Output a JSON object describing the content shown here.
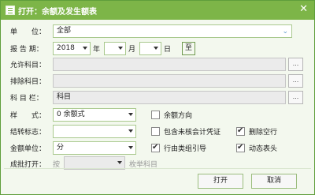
{
  "window": {
    "title": "打开：余额及发生额表",
    "close_symbol": "✕"
  },
  "form": {
    "unit": {
      "label": "单　　位：",
      "value": "全部"
    },
    "period": {
      "label": "报 告 期：",
      "year_value": "2018",
      "year_unit": "年",
      "month_value": "",
      "month_unit": "月",
      "day_value": "",
      "day_unit": "日",
      "to_button": "至"
    },
    "allowed_accounts": {
      "label": "允许科目：",
      "value": ""
    },
    "excluded_accounts": {
      "label": "排除科目：",
      "value": ""
    },
    "account_column": {
      "label": "科 目 栏：",
      "value": "科目"
    },
    "style": {
      "label": "样　　式：",
      "value": "0 余额式"
    },
    "carry_flag": {
      "label": "结转标志：",
      "value": ""
    },
    "amount_unit": {
      "label": "金额单位：",
      "value": "分"
    },
    "batch_open": {
      "label": "成批打开：",
      "by": "按",
      "value": "",
      "suffix": "枚举科目"
    },
    "ellipsis": "..."
  },
  "options": {
    "balance_direction": {
      "label": "余额方向",
      "checked": false
    },
    "include_unaudited": {
      "label": "包含未核会计凭证",
      "checked": false
    },
    "delete_empty_rows": {
      "label": "删除空行",
      "checked": true
    },
    "row_group_guide": {
      "label": "行由类组引导",
      "checked": true
    },
    "dynamic_header": {
      "label": "动态表头",
      "checked": true
    }
  },
  "buttons": {
    "open": "打开",
    "cancel": "取消"
  }
}
